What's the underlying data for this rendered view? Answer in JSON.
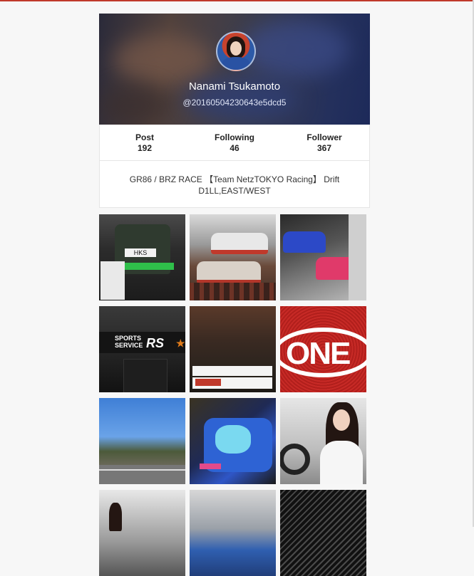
{
  "profile": {
    "name": "Nanami Tsukamoto",
    "handle": "@20160504230643e5dcd5",
    "bio": "GR86 / BRZ RACE 【Team NetzTOKYO Racing】 Drift D1LL,EAST/WEST"
  },
  "stats": [
    {
      "label": "Post",
      "value": "192"
    },
    {
      "label": "Following",
      "value": "46"
    },
    {
      "label": "Follower",
      "value": "367"
    }
  ],
  "tiles": {
    "hks": "HKS",
    "sports_service_1": "SPORTS",
    "sports_service_2": "SERVICE",
    "rs": "RS",
    "rs_star": "★R",
    "one": "ONE"
  },
  "colors": {
    "accent_rule": "#c0392b",
    "card_bg": "#ffffff",
    "page_bg": "#f7f7f7"
  }
}
